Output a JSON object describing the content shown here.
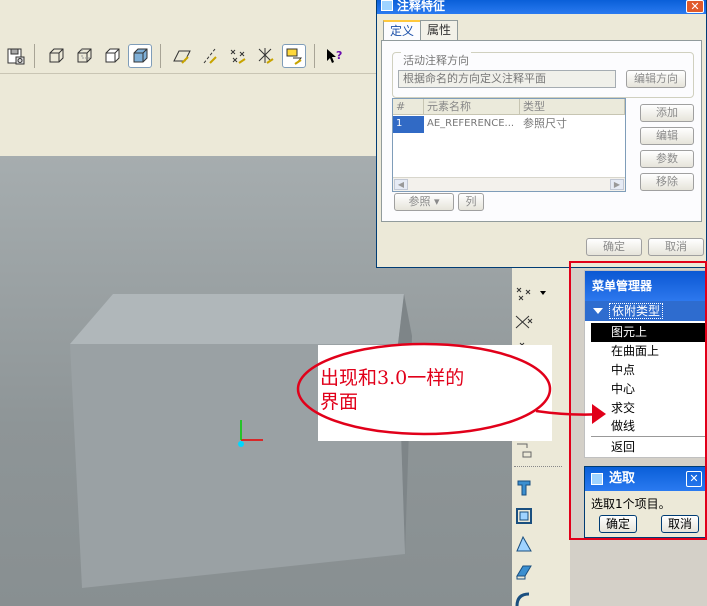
{
  "colors": {
    "accent_red": "#e1001a",
    "title_blue": "#0a5fd8",
    "selection_blue": "#316ac5",
    "ui_beige": "#ece9d8",
    "model_front": "#9aa1a4"
  },
  "toolbar": {
    "icons": [
      "save-copy-icon",
      "view-cube-wireframe-icon",
      "view-cube-hidden-icon",
      "view-cube-nohidden-icon",
      "view-cube-shaded-icon",
      "datum-plane-display-icon",
      "datum-axis-display-icon",
      "datum-point-display-icon",
      "coordinate-system-display-icon",
      "annotation-display-icon",
      "context-help-icon"
    ]
  },
  "annotation_dialog": {
    "title": "注释特征",
    "tabs": [
      "定义",
      "属性"
    ],
    "active_tab": "定义",
    "group_title": "活动注释方向",
    "direction_field": "根据命名的方向定义注释平面",
    "edit_direction_button": "编辑方向",
    "table": {
      "columns": [
        "#",
        "元素名称",
        "类型"
      ],
      "rows": [
        {
          "index": "1",
          "name": "AE_REFERENCE...",
          "type": "参照尺寸"
        }
      ]
    },
    "side_buttons": [
      "添加",
      "编辑",
      "参数",
      "移除"
    ],
    "reference_button": "参照",
    "column_button": "列",
    "ok_button": "确定",
    "cancel_button": "取消"
  },
  "menu_manager": {
    "title": "菜单管理器",
    "section": "依附类型",
    "items": [
      "图元上",
      "在曲面上",
      "中点",
      "中心",
      "求交",
      "做线"
    ],
    "selected_item": "图元上",
    "back_item": "返回"
  },
  "select_dialog": {
    "title": "选取",
    "message": "选取1个项目。",
    "ok_button": "确定",
    "cancel_button": "取消"
  },
  "callout": {
    "line1": "出现和3.0一样的",
    "line2": "界面"
  }
}
